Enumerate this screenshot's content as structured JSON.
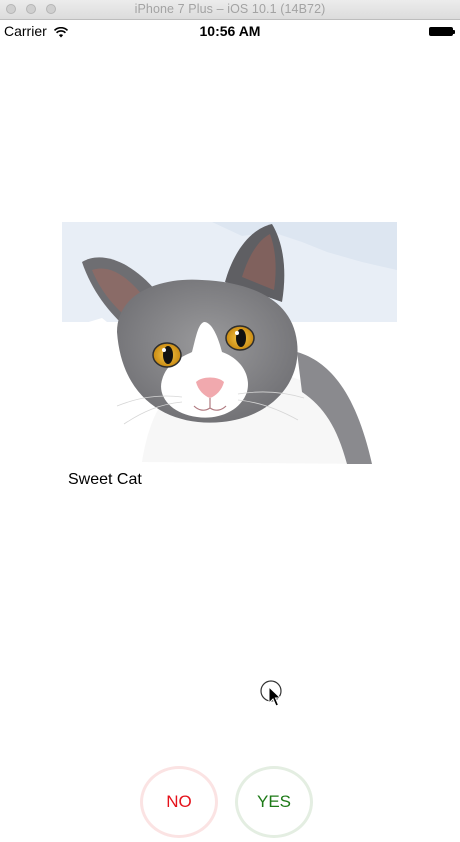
{
  "window": {
    "title": "iPhone 7 Plus – iOS 10.1 (14B72)"
  },
  "status_bar": {
    "carrier": "Carrier",
    "time": "10:56 AM",
    "wifi_icon": "wifi-icon",
    "battery_icon": "battery-icon",
    "battery_level": 1.0
  },
  "card": {
    "image_subject": "cat-photo",
    "caption": "Sweet Cat"
  },
  "actions": {
    "no_label": "NO",
    "yes_label": "YES",
    "no_color": "#e5121b",
    "yes_color": "#1d7a17"
  },
  "colors": {
    "background": "#ffffff",
    "no_border": "#fbe3e3",
    "yes_border": "#e4eee2"
  }
}
